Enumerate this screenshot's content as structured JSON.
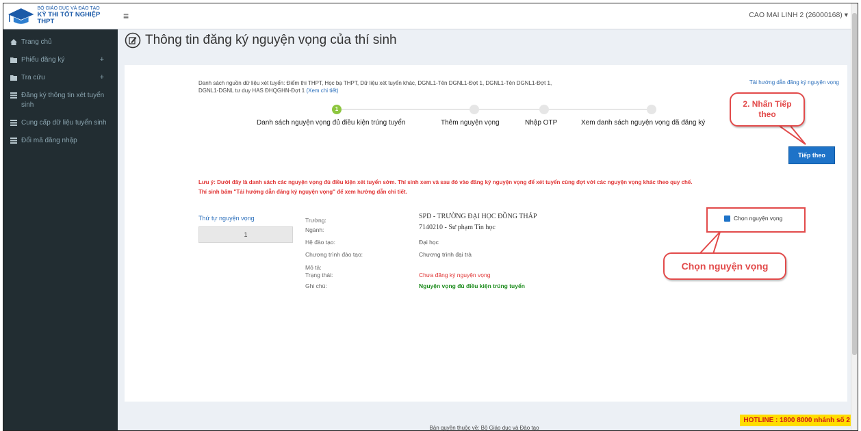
{
  "brand": {
    "top": "BỘ GIÁO DỤC VÀ ĐÀO TẠO",
    "bottom": "KỲ THI TỐT NGHIỆP THPT"
  },
  "sidebar": {
    "items": [
      {
        "label": "Trang chủ",
        "icon": "home-icon"
      },
      {
        "label": "Phiếu đăng ký",
        "icon": "folder-icon",
        "expand": "+"
      },
      {
        "label": "Tra cứu",
        "icon": "folder-icon",
        "expand": "+"
      },
      {
        "label": "Đăng ký thông tin xét tuyển sinh",
        "icon": "list-icon"
      },
      {
        "label": "Cung cấp dữ liệu tuyển sinh",
        "icon": "list-icon"
      },
      {
        "label": "Đổi mã đăng nhập",
        "icon": "list-icon"
      }
    ]
  },
  "topbar": {
    "menu_icon": "≡",
    "user": "CAO MAI LINH 2 (26000168)",
    "caret": "▾"
  },
  "page": {
    "title": "Thông tin đăng ký nguyện vọng của thí sinh"
  },
  "panel": {
    "source_text": "Danh sách nguồn dữ liệu xét tuyển: Điểm thi THPT, Học bạ THPT, Dữ liệu xét tuyển khác, DGNL1-Tên DGNL1-Đợt 1, DGNL1-Tên DGNL1-Đợt 1, DGNL1-DGNL tư duy HAS ĐHQGHN-Đợt 1",
    "source_link": "(Xem chi tiết)",
    "guide_link": "Tải hướng dẫn đăng ký nguyện vọng",
    "steps": [
      {
        "num": "1",
        "label": "Danh sách nguyện vọng đủ điều kiện trúng tuyển"
      },
      {
        "num": "",
        "label": "Thêm nguyện vọng"
      },
      {
        "num": "",
        "label": "Nhập OTP"
      },
      {
        "num": "",
        "label": "Xem danh sách nguyện vọng đã đăng ký"
      }
    ],
    "next_button": "Tiếp theo",
    "warning_line1": "Lưu ý: Dưới đây là danh sách các nguyện vọng đủ điều kiện xét tuyển sớm. Thí sinh xem và sau đó vào đăng ký nguyện vọng để xét tuyển cùng đợt với các nguyện vọng khác theo quy chế.",
    "warning_line2": "Thí sinh bấm \"Tải hướng dẫn đăng ký nguyện vọng\" để xem hướng dẫn chi tiết.",
    "order_label": "Thứ tự nguyện vọng",
    "order_value": "1",
    "details": [
      {
        "label": "Trường:",
        "value": "SPD - TRƯỜNG ĐẠI HỌC ĐỒNG THÁP"
      },
      {
        "label": "Ngành:",
        "value": "7140210 - Sư phạm Tin học"
      },
      {
        "label": "Hệ đào tạo:",
        "value": "Đại học"
      },
      {
        "label": "Chương trình đào tạo:",
        "value": "Chương trình đại trà"
      },
      {
        "label": "Mô tả:",
        "value": ""
      },
      {
        "label": "Trạng thái:",
        "value": "Chưa đăng ký nguyện vọng"
      },
      {
        "label": "Ghi chú:",
        "value": "Nguyện vọng đủ điều kiện trúng tuyển"
      }
    ],
    "choose_label": "Chọn nguyện vọng"
  },
  "callouts": {
    "next_line1": "2. Nhấn Tiếp",
    "next_line2": "theo",
    "choose": "Chọn nguyện vọng"
  },
  "footer": {
    "copyright": "Bản quyền thuộc về: Bộ Giáo dục và Đào tạo",
    "hotline": "HOTLINE : 1800 8000 nhánh số 2"
  },
  "colors": {
    "sidebar": "#222d32",
    "accent": "#1e73c8",
    "warning": "#e03333",
    "step_active": "#8dc63f",
    "callout": "#e24a4a",
    "hotline_bg": "#ffdd00"
  }
}
